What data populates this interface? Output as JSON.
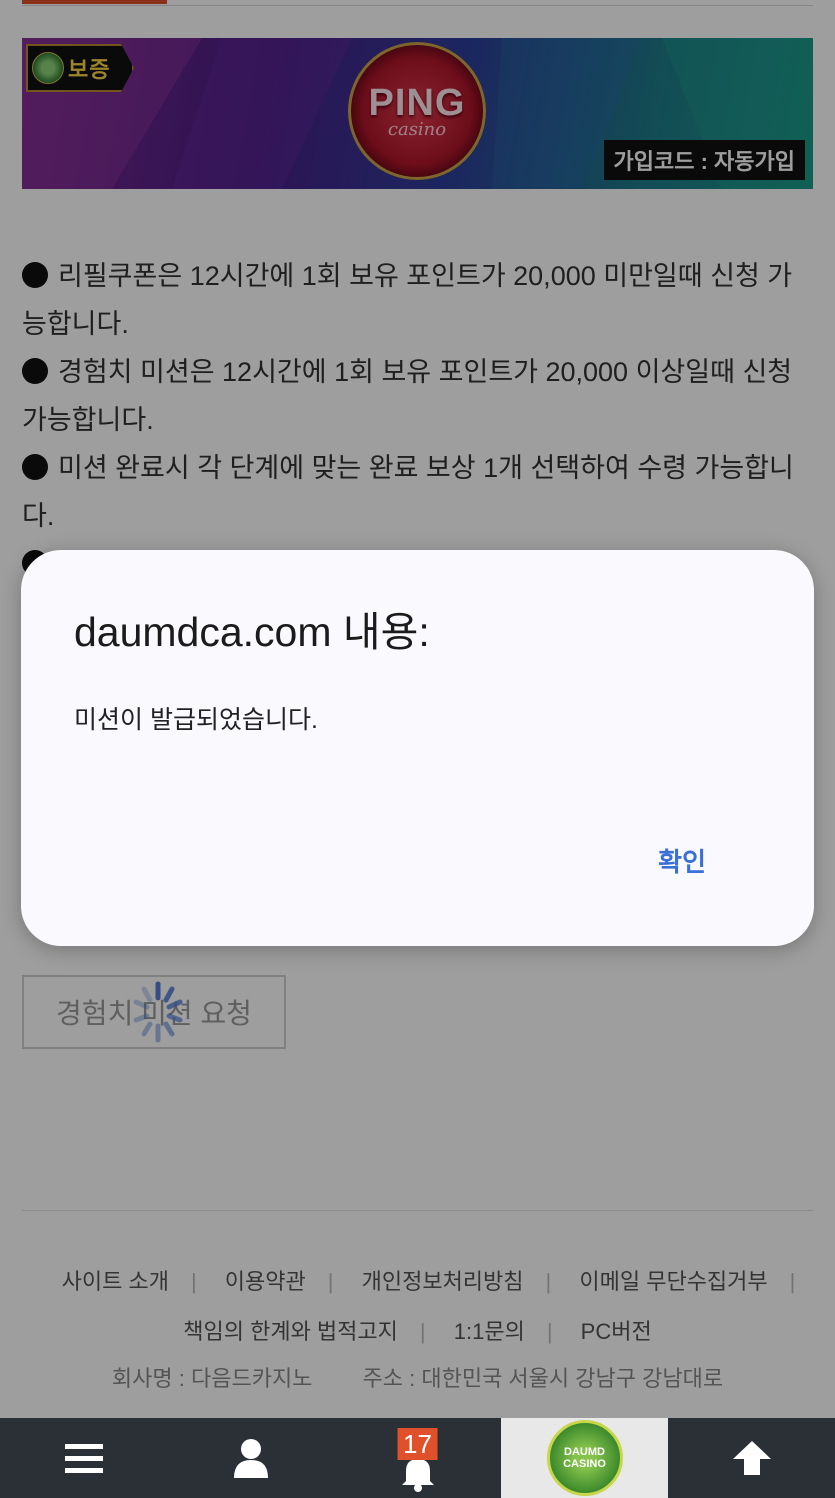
{
  "banner": {
    "badge_label": "보증",
    "logo_title": "PING",
    "logo_sub": "casino",
    "signup_code": "가입코드 : 자동가입"
  },
  "notice": [
    "리필쿠폰은 12시간에 1회 보유 포인트가 20,000 미만일때 신청 가능합니다.",
    "경험치 미션은 12시간에 1회 보유 포인트가 20,000 이상일때 신청 가능합니다.",
    "미션 완료시 각 단계에 맞는 완료 보상 1개 선택하여 수령 가능합니다."
  ],
  "mission_button": "경험치 미션 요청",
  "footer": {
    "links_row1": [
      "사이트 소개",
      "이용약관",
      "개인정보처리방침",
      "이메일 무단수집거부"
    ],
    "links_row2": [
      "책임의 한계와 법적고지",
      "1:1문의",
      "PC버전"
    ],
    "company": "회사명 : 다음드카지노",
    "address": "주소 : 대한민국 서울시 강남구 강남대로"
  },
  "bottom_nav": {
    "menu_icon": "hamburger-icon",
    "user_icon": "user-icon",
    "bell_icon": "bell-icon",
    "notification_count": "17",
    "logo_text_1": "DAUMD",
    "logo_text_2": "CASINO",
    "top_icon": "arrow-up-icon"
  },
  "dialog": {
    "title": "daumdca.com 내용:",
    "message": "미션이 발급되었습니다.",
    "ok_label": "확인"
  },
  "colors": {
    "accent": "#e0502a",
    "dialog_link": "#3a6fd8",
    "nav_bg": "#2b2f36"
  }
}
